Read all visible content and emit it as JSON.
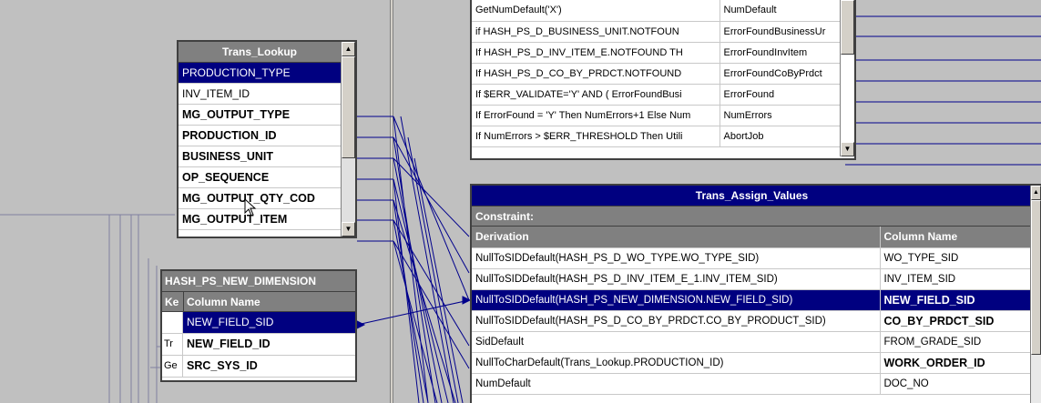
{
  "trans_lookup": {
    "title": "Trans_Lookup",
    "rows": [
      "PRODUCTION_TYPE",
      "INV_ITEM_ID",
      "MG_OUTPUT_TYPE",
      "PRODUCTION_ID",
      "BUSINESS_UNIT",
      "OP_SEQUENCE",
      "MG_OUTPUT_QTY_COD",
      "MG_OUTPUT_ITEM"
    ]
  },
  "hash_new_dim": {
    "title": "HASH_PS_NEW_DIMENSION",
    "header_key": "Ke",
    "header_col": "Column Name",
    "rows": [
      {
        "key": "",
        "col": "NEW_FIELD_SID"
      },
      {
        "key": "Tr",
        "col": "NEW_FIELD_ID"
      },
      {
        "key": "Ge",
        "col": "SRC_SYS_ID"
      }
    ]
  },
  "top_grid": {
    "rows": [
      {
        "derivation": "GetNumDefault('X')",
        "column": "NumDefault"
      },
      {
        "derivation": "if HASH_PS_D_BUSINESS_UNIT.NOTFOUN",
        "column": "ErrorFoundBusinessUr"
      },
      {
        "derivation": "If HASH_PS_D_INV_ITEM_E.NOTFOUND TH",
        "column": "ErrorFoundInvItem"
      },
      {
        "derivation": "If HASH_PS_D_CO_BY_PRDCT.NOTFOUND",
        "column": "ErrorFoundCoByPrdct"
      },
      {
        "derivation": "If $ERR_VALIDATE='Y' AND ( ErrorFoundBusi",
        "column": "ErrorFound"
      },
      {
        "derivation": "If ErrorFound = 'Y' Then NumErrors+1 Else Num",
        "column": "NumErrors"
      },
      {
        "derivation": "If NumErrors > $ERR_THRESHOLD Then Utili",
        "column": "AbortJob"
      }
    ]
  },
  "assign": {
    "title": "Trans_Assign_Values",
    "constraint_label": "Constraint:",
    "col_derivation": "Derivation",
    "col_name": "Column Name",
    "rows": [
      {
        "derivation": "NullToSIDDefault(HASH_PS_D_WO_TYPE.WO_TYPE_SID)",
        "column": "WO_TYPE_SID"
      },
      {
        "derivation": "NullToSIDDefault(HASH_PS_D_INV_ITEM_E_1.INV_ITEM_SID)",
        "column": "INV_ITEM_SID"
      },
      {
        "derivation": "NullToSIDDefault(HASH_PS_NEW_DIMENSION.NEW_FIELD_SID)",
        "column": "NEW_FIELD_SID"
      },
      {
        "derivation": "NullToSIDDefault(HASH_PS_D_CO_BY_PRDCT.CO_BY_PRODUCT_SID)",
        "column": "CO_BY_PRDCT_SID"
      },
      {
        "derivation": "SidDefault",
        "column": "FROM_GRADE_SID"
      },
      {
        "derivation": "NullToCharDefault(Trans_Lookup.PRODUCTION_ID)",
        "column": "WORK_ORDER_ID"
      },
      {
        "derivation": "NumDefault",
        "column": "DOC_NO"
      }
    ]
  },
  "colors": {
    "link": "#00008b",
    "selected": "#000080",
    "header": "#808080",
    "background": "#c0c0c0"
  }
}
